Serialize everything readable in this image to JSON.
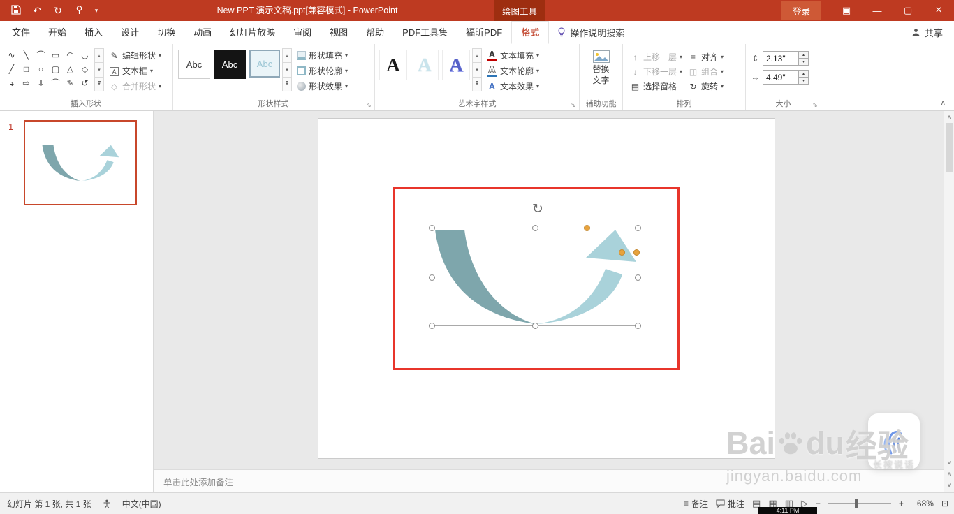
{
  "colors": {
    "titlebar": "#BE3A21",
    "contextual": "#9E2E10",
    "annotation": "#E8352B",
    "shape_dark": "#7EA6AC",
    "shape_light": "#A9D2DA",
    "handle_orange": "#E8A33D",
    "thumb_border": "#C8472B"
  },
  "icons": {
    "caret": "▾",
    "undo": "↶",
    "redo": "↻",
    "customize_qat": "▾",
    "spin_up": "▴",
    "spin_down": "▾",
    "chevron_up": "∧",
    "chevron_down": "∨",
    "ribbon_display": "▣",
    "minimize": "—",
    "restore": "▢",
    "close": "×",
    "launcher": "⇘",
    "edit_shape": "✎",
    "text_box": "A",
    "merge_shapes": "◇",
    "wordart_a": "A",
    "bring_forward": "↑",
    "send_backward": "↓",
    "selection_pane": "▤",
    "align": "≡",
    "group": "◫",
    "rotate": "↻",
    "height": "⇕",
    "width": "⇔",
    "notes": "≡",
    "view_normal": "▤",
    "view_sorter": "▦",
    "view_reading": "▥",
    "view_slideshow": "▷",
    "zoom_out": "−",
    "zoom_in": "+",
    "fit": "⊡",
    "rotate_handle": "↻"
  },
  "titlebar": {
    "title": "New PPT 演示文稿.ppt[兼容模式] - PowerPoint",
    "contextual_label": "绘图工具",
    "signin_label": "登录",
    "clock": "4:11 PM"
  },
  "tabs": {
    "items": [
      "文件",
      "开始",
      "插入",
      "设计",
      "切换",
      "动画",
      "幻灯片放映",
      "审阅",
      "视图",
      "帮助",
      "PDF工具集",
      "福昕PDF",
      "格式"
    ],
    "search_label": "操作说明搜索",
    "share_label": "共享"
  },
  "ribbon": {
    "insert_shapes": {
      "label": "插入形状",
      "shape_glyphs": [
        "∿",
        "╲",
        "⌒",
        "▭",
        "◠",
        "◡",
        "╱",
        "□",
        "○",
        "▢",
        "△",
        "◇",
        "↳",
        "⇨",
        "⇩",
        "⌒",
        "✎",
        "↺"
      ],
      "edit_shape": "编辑形状",
      "text_box": "文本框",
      "merge_shapes": "合并形状"
    },
    "shape_styles": {
      "label": "形状样式",
      "presets": [
        "Abc",
        "Abc",
        "Abc"
      ],
      "fill": "形状填充",
      "outline": "形状轮廓",
      "effects": "形状效果"
    },
    "wordart": {
      "label": "艺术字样式",
      "presets": [
        "A",
        "A",
        "A"
      ],
      "fill": "文本填充",
      "outline": "文本轮廓",
      "effects": "文本效果"
    },
    "accessibility": {
      "label": "辅助功能",
      "alt_text_line1": "替换",
      "alt_text_line2": "文字"
    },
    "arrange": {
      "label": "排列",
      "bring_forward": "上移一层",
      "send_backward": "下移一层",
      "selection_pane": "选择窗格",
      "align": "对齐",
      "group": "组合",
      "rotate": "旋转"
    },
    "size": {
      "label": "大小",
      "height_value": "2.13\"",
      "width_value": "4.49\""
    }
  },
  "slides_panel": {
    "slide_number": "1"
  },
  "notes": {
    "placeholder": "单击此处添加备注"
  },
  "statusbar": {
    "slide_info": "幻灯片 第 1 张, 共 1 张",
    "language": "中文(中国)",
    "notes_label": "备注",
    "comments_label": "批注",
    "zoom_level": "68%"
  },
  "watermark": {
    "brand": "Bai",
    "brand2": "du",
    "brand_cn": "经验",
    "url": "jingyan.baidu.com",
    "voice_hint": "长按说话"
  }
}
